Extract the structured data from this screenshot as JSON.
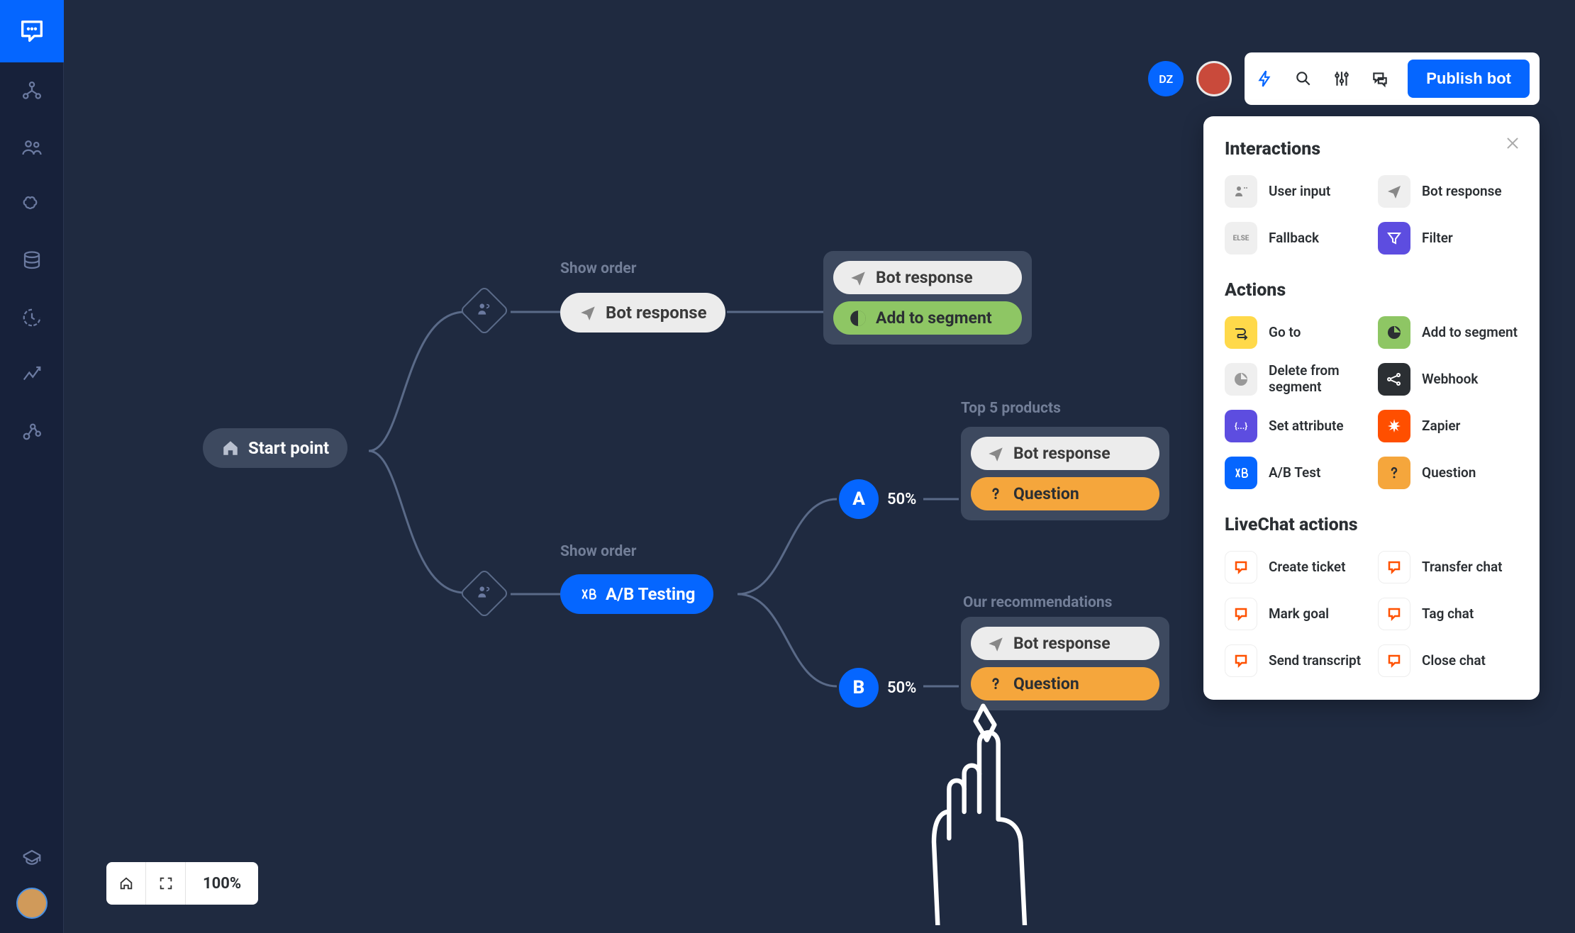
{
  "topbar": {
    "badge_initials": "DZ",
    "publish_label": "Publish bot"
  },
  "flow": {
    "start_label": "Start point",
    "node1_title": "Show order",
    "node1_pill": "Bot response",
    "box1_pill1": "Bot response",
    "box1_pill2": "Add to segment",
    "node2_title": "Show order",
    "abtest_label": "A/B Testing",
    "a_letter": "A",
    "a_pct": "50%",
    "b_letter": "B",
    "b_pct": "50%",
    "box2_title": "Top 5 products",
    "box2_pill1": "Bot response",
    "box2_pill2": "Question",
    "box3_title": "Our recommendations",
    "box3_pill1": "Bot response",
    "box3_pill2": "Question"
  },
  "panel": {
    "section1_title": "Interactions",
    "section2_title": "Actions",
    "section3_title": "LiveChat actions",
    "interactions": {
      "user_input": "User input",
      "bot_response": "Bot response",
      "fallback": "Fallback",
      "fallback_badge": "ELSE",
      "filter": "Filter"
    },
    "actions": {
      "goto": "Go to",
      "add_segment": "Add to segment",
      "delete_segment": "Delete from segment",
      "webhook": "Webhook",
      "set_attribute": "Set attribute",
      "zapier": "Zapier",
      "ab_test": "A/B Test",
      "question": "Question"
    },
    "livechat": {
      "create_ticket": "Create ticket",
      "transfer_chat": "Transfer chat",
      "mark_goal": "Mark goal",
      "tag_chat": "Tag chat",
      "send_transcript": "Send transcript",
      "close_chat": "Close chat"
    }
  },
  "zoom": {
    "value": "100%"
  }
}
